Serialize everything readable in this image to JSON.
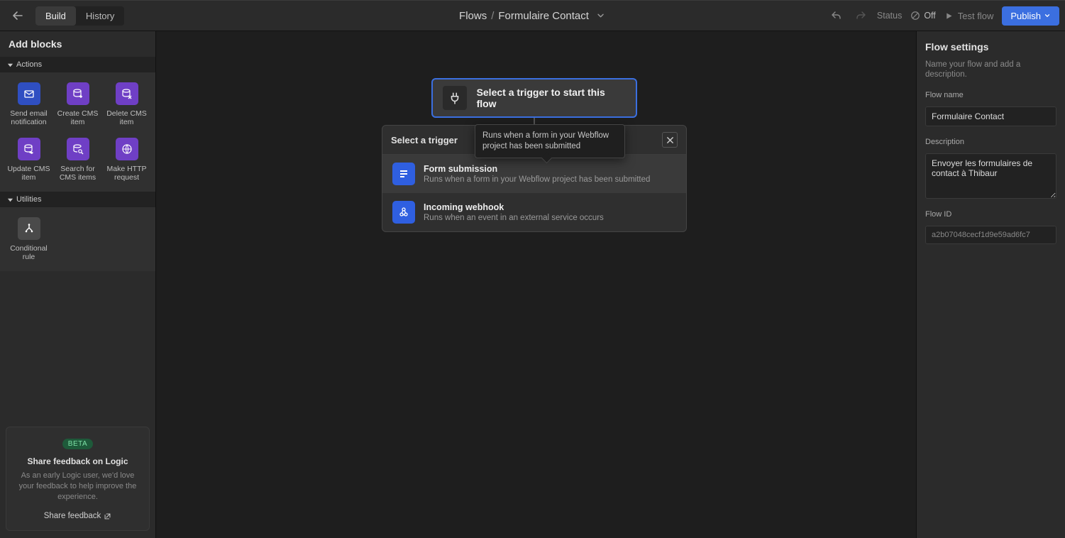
{
  "topbar": {
    "tab_build": "Build",
    "tab_history": "History",
    "breadcrumb_root": "Flows",
    "breadcrumb_sep": "/",
    "breadcrumb_leaf": "Formulaire Contact",
    "status_label": "Status",
    "status_value": "Off",
    "test_flow": "Test flow",
    "publish": "Publish"
  },
  "sidebar": {
    "title": "Add blocks",
    "sections": {
      "actions": "Actions",
      "utilities": "Utilities"
    },
    "blocks": {
      "send_email": "Send email notification",
      "create_cms": "Create CMS item",
      "delete_cms": "Delete CMS item",
      "update_cms": "Update CMS item",
      "search_cms": "Search for CMS items",
      "http": "Make HTTP request",
      "conditional": "Conditional rule"
    },
    "feedback": {
      "pill": "BETA",
      "title": "Share feedback on Logic",
      "body": "As an early Logic user, we'd love your feedback to help improve the experience.",
      "link": "Share feedback"
    }
  },
  "canvas": {
    "trigger_card": "Select a trigger to start this flow",
    "panel_title": "Select a trigger",
    "tooltip": "Runs when a form in your Webflow project has been submitted",
    "options": {
      "form_title": "Form submission",
      "form_desc": "Runs when a form in your Webflow project has been submitted",
      "hook_title": "Incoming webhook",
      "hook_desc": "Runs when an event in an external service occurs"
    }
  },
  "rightpanel": {
    "title": "Flow settings",
    "sub": "Name your flow and add a description.",
    "name_label": "Flow name",
    "name_value": "Formulaire Contact",
    "desc_label": "Description",
    "desc_value": "Envoyer les formulaires de contact à Thibaur",
    "id_label": "Flow ID",
    "id_value": "a2b07048cecf1d9e59ad6fc7"
  }
}
